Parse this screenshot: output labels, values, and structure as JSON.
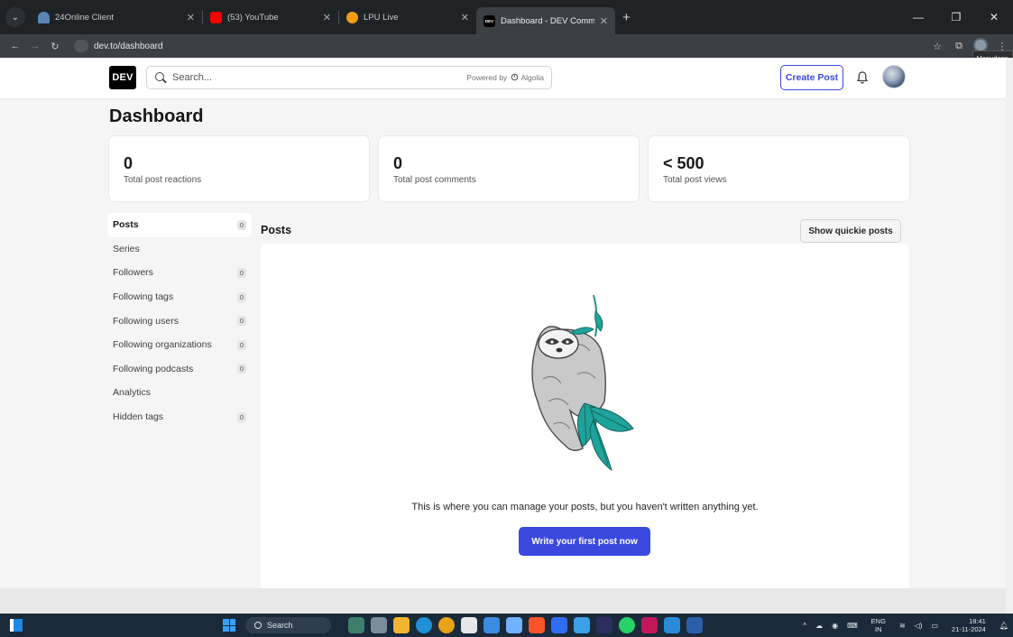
{
  "browser": {
    "tabs": [
      {
        "title": "24Online Client",
        "favicon_color": "#5a86b8"
      },
      {
        "title": "(53) YouTube",
        "favicon_color": "#ff0000"
      },
      {
        "title": "LPU Live",
        "favicon_color": "#f39c12"
      },
      {
        "title": "Dashboard - DEV Community",
        "favicon_color": "#000000",
        "favicon_text": "DEV",
        "active": true
      }
    ],
    "new_tab": "+",
    "url": "dev.to/dashboard",
    "tooltip": "Manudeep"
  },
  "header": {
    "logo": "DEV",
    "search_placeholder": "Search...",
    "powered_by": "Powered by",
    "powered_brand": "Algolia",
    "create_post": "Create Post"
  },
  "dashboard": {
    "title": "Dashboard",
    "stats": [
      {
        "value": "0",
        "label": "Total post reactions"
      },
      {
        "value": "0",
        "label": "Total post comments"
      },
      {
        "value": "< 500",
        "label": "Total post views"
      }
    ]
  },
  "sidebar": {
    "items": [
      {
        "label": "Posts",
        "count": "0",
        "active": true
      },
      {
        "label": "Series",
        "count": ""
      },
      {
        "label": "Followers",
        "count": "0"
      },
      {
        "label": "Following tags",
        "count": "0"
      },
      {
        "label": "Following users",
        "count": "0"
      },
      {
        "label": "Following organizations",
        "count": "0"
      },
      {
        "label": "Following podcasts",
        "count": "0"
      },
      {
        "label": "Analytics",
        "count": ""
      },
      {
        "label": "Hidden tags",
        "count": "0"
      }
    ]
  },
  "posts": {
    "title": "Posts",
    "quickie_button": "Show quickie posts",
    "empty_message": "This is where you can manage your posts, but you haven't written anything yet.",
    "write_button": "Write your first post now"
  },
  "taskbar": {
    "search": "Search",
    "lang_top": "ENG",
    "lang_bottom": "IN",
    "time": "18:41",
    "date": "21-11-2024"
  },
  "colors": {
    "accent": "#3b49df",
    "sloth_leaf": "#1fa39a"
  }
}
